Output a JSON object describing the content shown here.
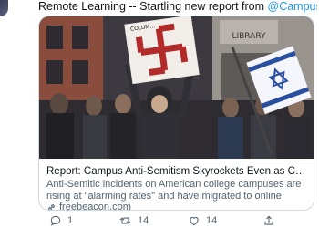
{
  "tweet": {
    "text_prefix": "Remote Learning -- Startling new report from ",
    "mention": "@CampusFairness"
  },
  "card": {
    "title": "Report: Campus Anti-Semitism Skyrockets Even as Coronavirus Forces R...",
    "description": "Anti-Semitic incidents on American college campuses are rising at \"alarming rates\" and have migrated to online spaces as students have ...",
    "domain": "freebeacon.com",
    "sign_text_top": "COLUM...",
    "building_sign": "LIBRARY"
  },
  "actions": {
    "reply_count": "1",
    "retweet_count": "14",
    "like_count": "14"
  },
  "colors": {
    "accent": "#1d9bf0",
    "muted": "#536471",
    "border": "#cfd9de"
  }
}
